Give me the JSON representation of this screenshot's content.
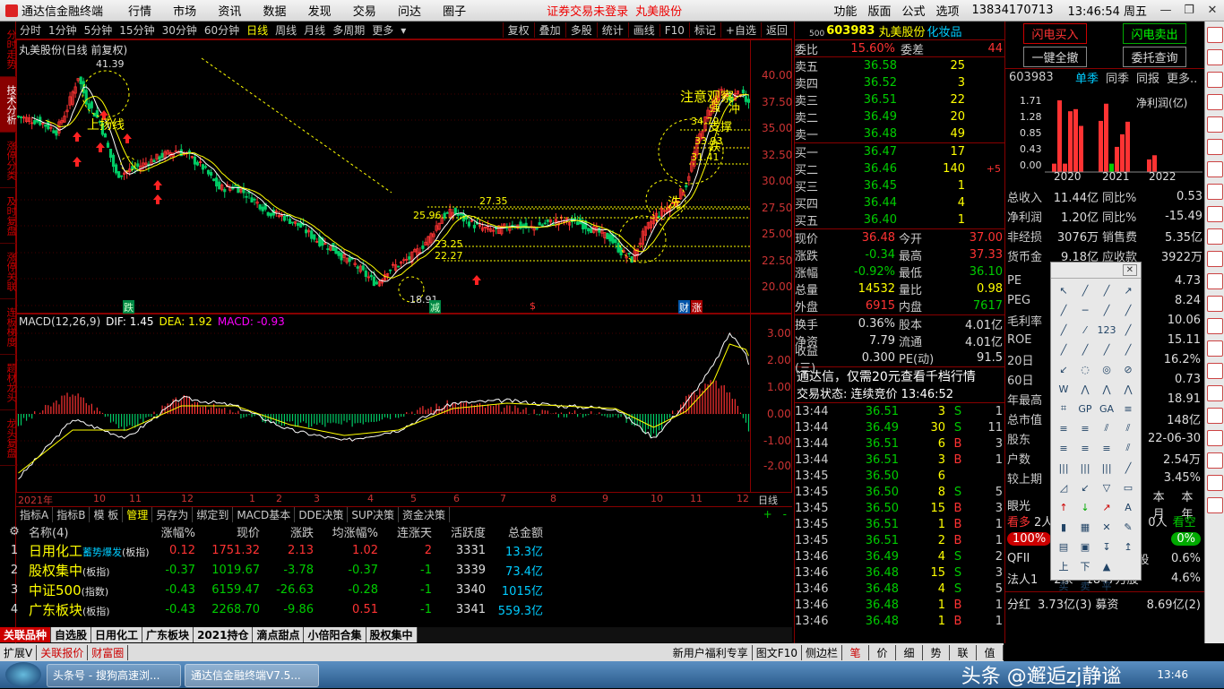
{
  "titlebar": {
    "app_title": "通达信金融终端",
    "menus": [
      "行情",
      "市场",
      "资讯",
      "数据",
      "发现",
      "交易",
      "问达",
      "圈子"
    ],
    "notice": "证券交易未登录",
    "stock_short": "丸美股份",
    "right_menus": [
      "功能",
      "版面",
      "公式",
      "选项"
    ],
    "phone": "13834170713",
    "time": "13:46:54 周五"
  },
  "vtabs": [
    "分时走势",
    "技术分析",
    "涨停分类",
    "及时复盘",
    "涨停关联",
    "连板梯度",
    "题材龙头",
    "龙头复盘"
  ],
  "kbar": {
    "periods": [
      "分时",
      "1分钟",
      "5分钟",
      "15分钟",
      "30分钟",
      "60分钟",
      "日线",
      "周线",
      "月线",
      "多周期",
      "更多"
    ],
    "active": "日线",
    "tools": [
      "复权",
      "叠加",
      "多股",
      "统计",
      "画线",
      "F10",
      "标记",
      "+自选",
      "返回"
    ]
  },
  "kchart": {
    "title": "丸美股份(日线 前复权)",
    "y_ticks": [
      "40.00",
      "37.50",
      "35.00",
      "32.50",
      "30.00",
      "27.50",
      "25.00",
      "22.50",
      "20.00"
    ],
    "annotations": {
      "high": "41.39",
      "low": "18.91",
      "up_line": "上扬线",
      "watch": "注意观察",
      "wash": "洗",
      "p2735": "27.35",
      "p2596": "25.96",
      "p2325": "23.25",
      "p2227": "22.27",
      "p3479": "34.79",
      "p3393": "33.93",
      "p3141": "31.41",
      "break1": "冲",
      "break2": "跌",
      "bottom_mark": "跌",
      "mark_jian": "减",
      "mark_s": "$",
      "mark_cai": "财",
      "mark_zhang": "涨",
      "a1": "强",
      "a2": "支撑"
    }
  },
  "macd": {
    "title": "MACD(12,26,9)",
    "dif": "DIF: 1.45",
    "dea": "DEA: 1.92",
    "macd": "MACD: -0.93",
    "y_ticks": [
      "3.00",
      "2.00",
      "1.00",
      "0.00",
      "-1.00",
      "-2.00"
    ]
  },
  "xaxis": {
    "labels": [
      "2021年",
      "10",
      "11",
      "12",
      "1",
      "2",
      "3",
      "4",
      "5",
      "6",
      "7",
      "8",
      "9",
      "10",
      "11",
      "12"
    ],
    "period": "日线"
  },
  "indicator_tabs": [
    "指标A",
    "指标B",
    "模 板",
    "管理",
    "另存为",
    "绑定到",
    "MACD基本",
    "DDE决策",
    "SUP决策",
    "资金决策"
  ],
  "sector_table": {
    "columns": [
      "名称(4)",
      "涨幅%",
      "现价",
      "涨跌",
      "均涨幅%",
      "连涨天",
      "活跃度",
      "总金额"
    ],
    "rows": [
      {
        "idx": "1",
        "name": "日用化工",
        "tag": "蓄势爆发",
        "type": "(板指)",
        "chg_pct": "0.12",
        "price": "1751.32",
        "chg": "2.13",
        "avg": "1.02",
        "days": "2",
        "active": "3331",
        "amount": "13.3亿"
      },
      {
        "idx": "2",
        "name": "股权集中",
        "tag": "",
        "type": "(板指)",
        "chg_pct": "-0.37",
        "price": "1019.67",
        "chg": "-3.78",
        "avg": "-0.37",
        "days": "-1",
        "active": "3339",
        "amount": "73.4亿"
      },
      {
        "idx": "3",
        "name": "中证500",
        "tag": "",
        "type": "(指数)",
        "chg_pct": "-0.43",
        "price": "6159.47",
        "chg": "-26.63",
        "avg": "-0.28",
        "days": "-1",
        "active": "3340",
        "amount": "1015亿"
      },
      {
        "idx": "4",
        "name": "广东板块",
        "tag": "",
        "type": "(板指)",
        "chg_pct": "-0.43",
        "price": "2268.70",
        "chg": "-9.86",
        "avg": "0.51",
        "days": "-1",
        "active": "3341",
        "amount": "559.3亿"
      }
    ]
  },
  "bottom_tabs": [
    "关联品种",
    "自选股",
    "日用化工",
    "广东板块",
    "2021持仓",
    "滴点甜点",
    "小倍阳合集",
    "股权集中"
  ],
  "status_bar": {
    "left": [
      "扩展V",
      "关联报价",
      "财富圈"
    ],
    "right": [
      "新用户福利专享",
      "图文F10",
      "侧边栏"
    ],
    "right_tabs": [
      "笔",
      "价",
      "细",
      "势",
      "联",
      "值"
    ]
  },
  "quote": {
    "code": "603983",
    "name": "丸美股份",
    "industry": "化妆品",
    "code_prefix": "500",
    "weibi_label": "委比",
    "weibi": "15.60%",
    "weicha_label": "委差",
    "weicha": "44",
    "asks": [
      {
        "n": "卖五",
        "p": "36.58",
        "v": "25"
      },
      {
        "n": "卖四",
        "p": "36.52",
        "v": "3"
      },
      {
        "n": "卖三",
        "p": "36.51",
        "v": "22"
      },
      {
        "n": "卖二",
        "p": "36.49",
        "v": "20"
      },
      {
        "n": "卖一",
        "p": "36.48",
        "v": "49"
      }
    ],
    "bids": [
      {
        "n": "买一",
        "p": "36.47",
        "v": "17",
        "c": ""
      },
      {
        "n": "买二",
        "p": "36.46",
        "v": "140",
        "c": "+5"
      },
      {
        "n": "买三",
        "p": "36.45",
        "v": "1",
        "c": ""
      },
      {
        "n": "买四",
        "p": "36.44",
        "v": "4",
        "c": ""
      },
      {
        "n": "买五",
        "p": "36.40",
        "v": "1",
        "c": ""
      }
    ],
    "stats": [
      [
        "现价",
        "36.48",
        "今开",
        "37.00"
      ],
      [
        "涨跌",
        "-0.34",
        "最高",
        "37.33"
      ],
      [
        "涨幅",
        "-0.92%",
        "最低",
        "36.10"
      ],
      [
        "总量",
        "14532",
        "量比",
        "0.98"
      ],
      [
        "外盘",
        "6915",
        "内盘",
        "7617"
      ]
    ],
    "stats2": [
      [
        "换手",
        "0.36%",
        "股本",
        "4.01亿"
      ],
      [
        "净资",
        "7.79",
        "流通",
        "4.01亿"
      ],
      [
        "收益(三)",
        "0.300",
        "PE(动)",
        "91.5"
      ]
    ],
    "ad": "通达信，仅需20元查看千档行情",
    "trade_state": "交易状态: 连续竞价 13:46:52",
    "ticks": [
      [
        "13:44",
        "36.51",
        "3",
        "S",
        "1"
      ],
      [
        "13:44",
        "36.49",
        "30",
        "S",
        "11"
      ],
      [
        "13:44",
        "36.51",
        "6",
        "B",
        "3"
      ],
      [
        "13:44",
        "36.51",
        "3",
        "B",
        "1"
      ],
      [
        "13:45",
        "36.50",
        "6",
        "",
        ""
      ],
      [
        "13:45",
        "36.50",
        "8",
        "S",
        "5"
      ],
      [
        "13:45",
        "36.50",
        "15",
        "B",
        "3"
      ],
      [
        "13:45",
        "36.51",
        "1",
        "B",
        "1"
      ],
      [
        "13:45",
        "36.51",
        "2",
        "B",
        "1"
      ],
      [
        "13:46",
        "36.49",
        "4",
        "S",
        "2"
      ],
      [
        "13:46",
        "36.48",
        "15",
        "S",
        "3"
      ],
      [
        "13:46",
        "36.48",
        "4",
        "S",
        "5"
      ],
      [
        "13:46",
        "36.48",
        "1",
        "B",
        "1"
      ],
      [
        "13:46",
        "36.48",
        "1",
        "B",
        "1"
      ]
    ]
  },
  "fund": {
    "buttons": [
      "闪电买入",
      "闪电卖出",
      "一键全撤",
      "委托查询"
    ],
    "code": "603983",
    "tabs": [
      "单季",
      "同季",
      "同报",
      "更多.."
    ],
    "profit_label": "净利润(亿)",
    "y_ticks": [
      "1.71",
      "1.28",
      "0.85",
      "0.43",
      "0.00"
    ],
    "years": [
      "2020",
      "2021",
      "2022"
    ],
    "rows": [
      [
        "总收入",
        "11.44亿",
        "同比%",
        "0.53"
      ],
      [
        "净利润",
        "1.20亿",
        "同比%",
        "-15.49"
      ],
      [
        "非经损",
        "3076万",
        "销售费",
        "5.35亿"
      ],
      [
        "货币金",
        "9.18亿",
        "应收款",
        "3922万"
      ]
    ],
    "rows2": [
      [
        "PE",
        "4.73"
      ],
      [
        "PEG",
        "8.24"
      ],
      [
        "毛利率",
        "10.06"
      ],
      [
        "ROE",
        "15.11"
      ],
      [
        "20日",
        "16.2%"
      ],
      [
        "60日",
        "0.73"
      ],
      [
        "年最高",
        "18.91"
      ],
      [
        "总市值",
        "148亿"
      ],
      [
        "股东",
        "22-06-30"
      ],
      [
        "户数",
        "2.54万"
      ],
      [
        "较上期",
        "3.45%"
      ]
    ],
    "eye": "眼光",
    "kan": "看多",
    "people": "2人",
    "month": "本月",
    "year": "本年",
    "zero": "0人",
    "kan2": "看空",
    "pct100": "100%",
    "pct0": "0%",
    "qfii": "QFII",
    "qfii_v": "0.6%",
    "fr": "法人1",
    "fr_v1": "2家",
    "fr_v2": "1847万股",
    "fr_v3": "4.6%",
    "gu": "股",
    "fh": "分红",
    "fh_v": "3.73亿(3)",
    "mz": "募资",
    "mz_v": "8.69亿(2)"
  },
  "taskbar": {
    "tasks": [
      "头条号 - 搜狗高速浏...",
      "通达信金融终端V7.5..."
    ],
    "time": "13:46",
    "watermark": "头条 @邂逅zj静谧"
  },
  "colors": {
    "up": "#ff3333",
    "down": "#00cc00",
    "accent": "#ffff00",
    "frame": "#880000"
  }
}
